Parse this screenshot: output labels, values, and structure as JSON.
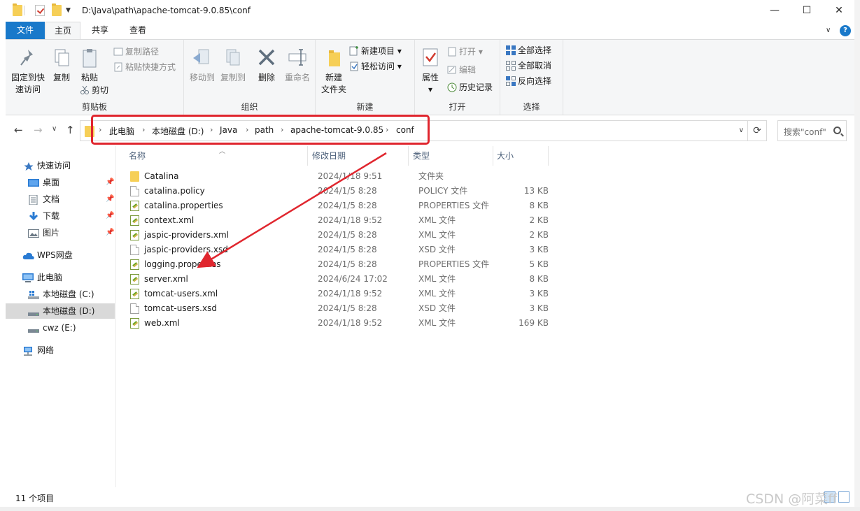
{
  "window": {
    "title_path": "D:\\Java\\path\\apache-tomcat-9.0.85\\conf",
    "minimize": "—",
    "maximize": "☐",
    "close": "✕"
  },
  "ribbon_tabs": {
    "file": "文件",
    "home": "主页",
    "share": "共享",
    "view": "查看",
    "help": "?"
  },
  "ribbon": {
    "clipboard": {
      "label": "剪贴板",
      "pin_quick_access": "固定到快\n速访问",
      "copy": "复制",
      "paste": "粘贴",
      "copy_path": "复制路径",
      "paste_shortcut": "粘贴快捷方式",
      "cut": "剪切"
    },
    "organize": {
      "label": "组织",
      "move_to": "移动到",
      "copy_to": "复制到",
      "delete": "删除",
      "rename": "重命名"
    },
    "new": {
      "label": "新建",
      "new_folder_line1": "新建",
      "new_folder_line2": "文件夹",
      "new_item": "新建项目",
      "easy_access": "轻松访问"
    },
    "open": {
      "label": "打开",
      "properties": "属性",
      "open": "打开",
      "edit": "编辑",
      "history": "历史记录"
    },
    "select": {
      "label": "选择",
      "select_all": "全部选择",
      "select_none": "全部取消",
      "invert": "反向选择"
    }
  },
  "address": {
    "crumbs": [
      "此电脑",
      "本地磁盘 (D:)",
      "Java",
      "path",
      "apache-tomcat-9.0.85",
      "conf"
    ],
    "search_placeholder": "搜索\"conf\""
  },
  "sidebar": {
    "quick_access": "快速访问",
    "desktop": "桌面",
    "documents": "文档",
    "downloads": "下载",
    "pictures": "图片",
    "wps": "WPS网盘",
    "this_pc": "此电脑",
    "drive_c": "本地磁盘 (C:)",
    "drive_d": "本地磁盘 (D:)",
    "drive_e": "cwz (E:)",
    "network": "网络"
  },
  "columns": {
    "name": "名称",
    "modified": "修改日期",
    "type": "类型",
    "size": "大小"
  },
  "files": [
    {
      "name": "Catalina",
      "date": "2024/1/18 9:51",
      "type": "文件夹",
      "size": "",
      "icon": "folder-icon"
    },
    {
      "name": "catalina.policy",
      "date": "2024/1/5 8:28",
      "type": "POLICY 文件",
      "size": "13 KB",
      "icon": "document-icon"
    },
    {
      "name": "catalina.properties",
      "date": "2024/1/5 8:28",
      "type": "PROPERTIES 文件",
      "size": "8 KB",
      "icon": "properties-file-icon"
    },
    {
      "name": "context.xml",
      "date": "2024/1/18 9:52",
      "type": "XML 文件",
      "size": "2 KB",
      "icon": "xml-file-icon"
    },
    {
      "name": "jaspic-providers.xml",
      "date": "2024/1/5 8:28",
      "type": "XML 文件",
      "size": "2 KB",
      "icon": "xml-file-icon"
    },
    {
      "name": "jaspic-providers.xsd",
      "date": "2024/1/5 8:28",
      "type": "XSD 文件",
      "size": "3 KB",
      "icon": "document-icon"
    },
    {
      "name": "logging.properties",
      "date": "2024/1/5 8:28",
      "type": "PROPERTIES 文件",
      "size": "5 KB",
      "icon": "properties-file-icon"
    },
    {
      "name": "server.xml",
      "date": "2024/6/24 17:02",
      "type": "XML 文件",
      "size": "8 KB",
      "icon": "xml-file-icon"
    },
    {
      "name": "tomcat-users.xml",
      "date": "2024/1/18 9:52",
      "type": "XML 文件",
      "size": "3 KB",
      "icon": "xml-file-icon"
    },
    {
      "name": "tomcat-users.xsd",
      "date": "2024/1/5 8:28",
      "type": "XSD 文件",
      "size": "3 KB",
      "icon": "document-icon"
    },
    {
      "name": "web.xml",
      "date": "2024/1/18 9:52",
      "type": "XML 文件",
      "size": "169 KB",
      "icon": "xml-file-icon"
    }
  ],
  "status": {
    "count": "11 个项目"
  },
  "watermark": "CSDN @阿菜ff",
  "colors": {
    "accent": "#1979ca",
    "highlight": "#e0262e"
  }
}
